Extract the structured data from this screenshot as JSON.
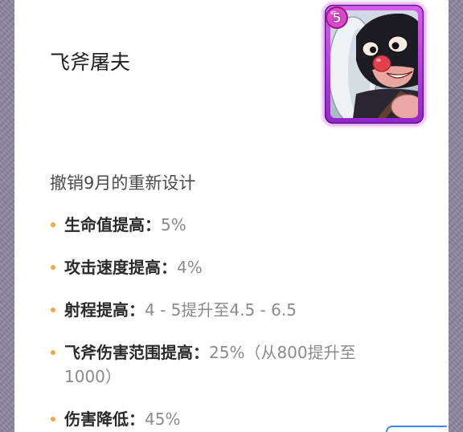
{
  "card": {
    "title": "飞斧屠夫",
    "elixir_cost": "5",
    "art_icon": "executioner-card-art",
    "frame_color": "#b43ae0",
    "elixir_color": "#e044c6"
  },
  "section": {
    "heading": "撤销9月的重新设计"
  },
  "changes": [
    {
      "label": "生命值提高：",
      "value": "5%"
    },
    {
      "label": "攻击速度提高：",
      "value": "4%"
    },
    {
      "label": "射程提高：",
      "value": "4 - 5提升至4.5 - 6.5"
    },
    {
      "label": "飞斧伤害范围提高：",
      "value": "25%（从800提升至1000）"
    },
    {
      "label": "伤害降低：",
      "value": "45%"
    }
  ],
  "colors": {
    "bullet": "#f2a93b",
    "page_background": "#8e86a2",
    "floating_button_outline": "#3d8bfd"
  },
  "icons": {
    "bullet": "bullet-dot-icon"
  }
}
